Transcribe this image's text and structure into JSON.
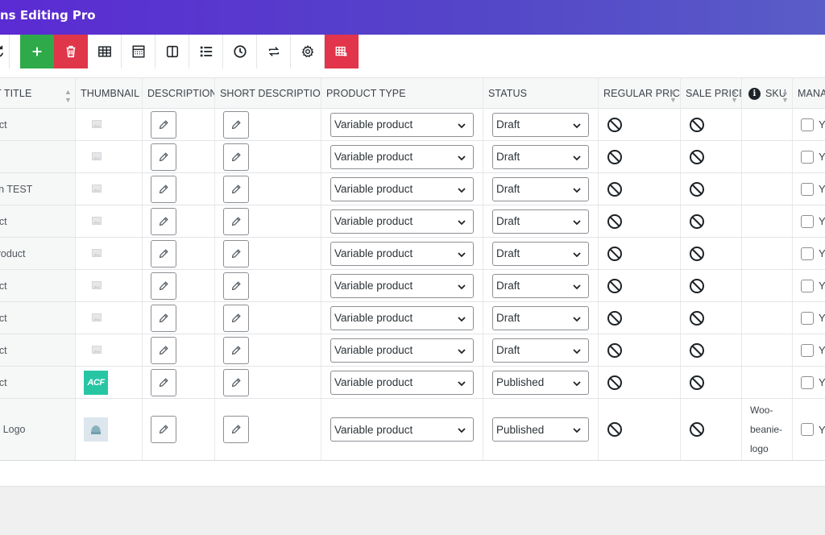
{
  "app": {
    "title": "ns Editing Pro"
  },
  "toolbar": {
    "buttons": [
      {
        "icon": "refresh-icon",
        "name": "reload-button"
      },
      {
        "icon": "plus-icon",
        "name": "add-product-button"
      },
      {
        "icon": "trash-icon",
        "name": "delete-button"
      },
      {
        "icon": "table-icon",
        "name": "table-view-button"
      },
      {
        "icon": "calculator-icon",
        "name": "bulk-edit-button"
      },
      {
        "icon": "columns-icon",
        "name": "column-manager-button"
      },
      {
        "icon": "list-icon",
        "name": "list-view-button"
      },
      {
        "icon": "history-icon",
        "name": "history-button"
      },
      {
        "icon": "swap-icon",
        "name": "import-export-button"
      },
      {
        "icon": "gear-icon",
        "name": "settings-button"
      },
      {
        "icon": "filter-table-icon",
        "name": "filter-button"
      }
    ],
    "colors": {
      "add": "#2eaa4a",
      "delete": "#e0364a",
      "filter": "#e2344a"
    }
  },
  "table": {
    "headers": {
      "title": "T TITLE",
      "thumbnail": "THUMBNAIL",
      "description": "DESCRIPTION",
      "short_description": "SHORT DESCRIPTION",
      "product_type": "PRODUCT TYPE",
      "status": "STATUS",
      "regular_price": "REGULAR PRICE",
      "sale_price": "SALE PRICE",
      "sku": "SKU",
      "manage": "MANA"
    },
    "rows": [
      {
        "title": "oduct",
        "thumb": "placeholder",
        "type": "Variable product",
        "status": "Draft",
        "sku": "",
        "manage": "Ye"
      },
      {
        "title": "",
        "thumb": "placeholder",
        "type": "Variable product",
        "status": "Draft",
        "sku": "",
        "manage": "Ye"
      },
      {
        "title": "ation TEST",
        "thumb": "placeholder",
        "type": "Variable product",
        "status": "Draft",
        "sku": "",
        "manage": "Ye"
      },
      {
        "title": "oduct",
        "thumb": "placeholder",
        "type": "Variable product",
        "status": "Draft",
        "sku": "",
        "manage": "Ye"
      },
      {
        "title": "e Product",
        "thumb": "placeholder",
        "type": "Variable product",
        "status": "Draft",
        "sku": "",
        "manage": "Ye"
      },
      {
        "title": "oduct",
        "thumb": "placeholder",
        "type": "Variable product",
        "status": "Draft",
        "sku": "",
        "manage": "Ye"
      },
      {
        "title": "oduct",
        "thumb": "placeholder",
        "type": "Variable product",
        "status": "Draft",
        "sku": "",
        "manage": "Ye"
      },
      {
        "title": "oduct",
        "thumb": "placeholder",
        "type": "Variable product",
        "status": "Draft",
        "sku": "",
        "manage": "Ye"
      },
      {
        "title": "oduct",
        "thumb": "acf",
        "thumb_text": "ACF",
        "type": "Variable product",
        "status": "Published",
        "sku": "",
        "manage": "Ye"
      },
      {
        "title": "with Logo",
        "thumb": "beanie",
        "type": "Variable product",
        "status": "Published",
        "sku": "Woo-beanie-logo",
        "sku_lines": [
          "Woo-",
          "beanie-",
          "logo"
        ],
        "manage": "Ye"
      }
    ]
  }
}
